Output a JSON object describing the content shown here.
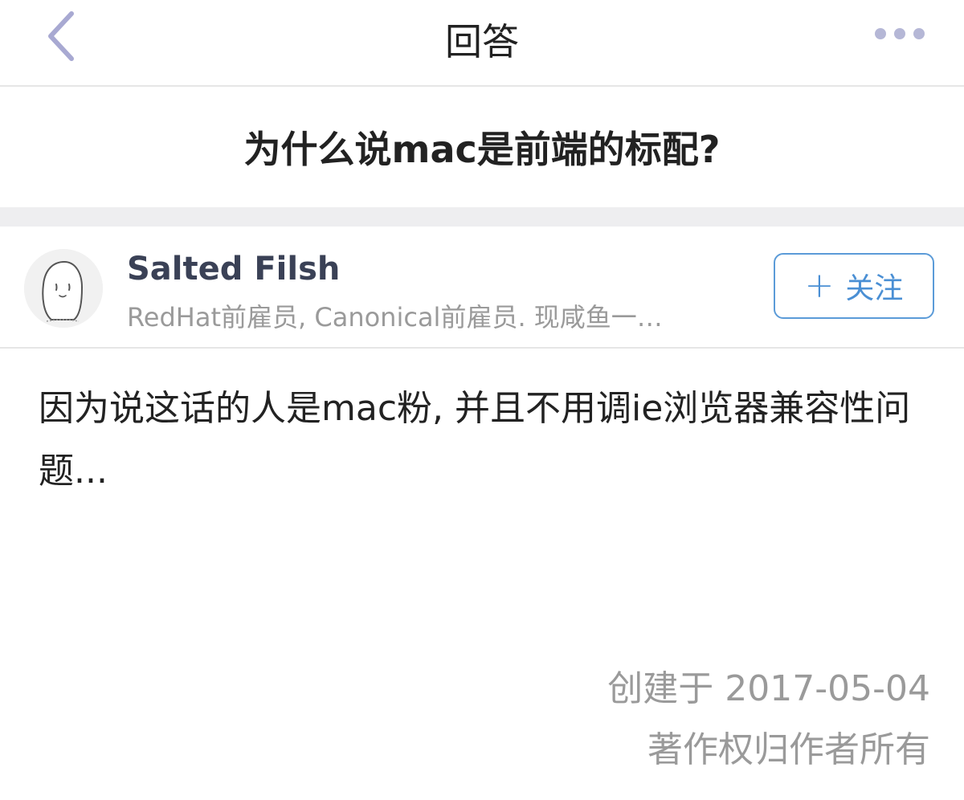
{
  "nav": {
    "title": "回答",
    "back_icon": "chevron-left-icon",
    "more_icon": "more-dots-icon",
    "icon_color": "#a8a9d2"
  },
  "question": {
    "title": "为什么说mac是前端的标配?"
  },
  "author": {
    "name": "Salted Filsh",
    "bio": "RedHat前雇员, Canonical前雇员. 现咸鱼一…",
    "follow_label": "关注",
    "follow_icon": "plus-icon",
    "accent": "#4a8fd4"
  },
  "answer": {
    "body": "因为说这话的人是mac粉, 并且不用调ie浏览器兼容性问题..."
  },
  "meta": {
    "created": "创建于 2017-05-04",
    "copyright": "著作权归作者所有"
  }
}
